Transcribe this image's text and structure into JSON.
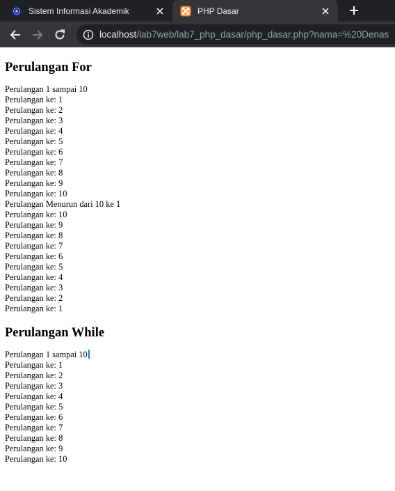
{
  "browser": {
    "tabs": [
      {
        "title": "Sistem Informasi Akademik",
        "active": false,
        "icon": "university-logo-icon"
      },
      {
        "title": "PHP Dasar",
        "active": true,
        "icon": "xampp-icon"
      }
    ],
    "url_host": "localhost",
    "url_path": "/lab7web/lab7_php_dasar/php_dasar.php?nama=%20Denas",
    "colors": {
      "tab_strip": "#202124",
      "toolbar": "#35363a",
      "xampp_orange": "#fb7a24"
    }
  },
  "page": {
    "for_section": {
      "heading": "Perulangan For",
      "lines": [
        "Perulangan 1 sampai 10",
        "Perulangan ke: 1",
        "Perulangan ke: 2",
        "Perulangan ke: 3",
        "Perulangan ke: 4",
        "Perulangan ke: 5",
        "Perulangan ke: 6",
        "Perulangan ke: 7",
        "Perulangan ke: 8",
        "Perulangan ke: 9",
        "Perulangan ke: 10",
        "Perulangan Menurun dari 10 ke 1",
        "Perulangan ke: 10",
        "Perulangan ke: 9",
        "Perulangan ke: 8",
        "Perulangan ke: 7",
        "Perulangan ke: 6",
        "Perulangan ke: 5",
        "Perulangan ke: 4",
        "Perulangan ke: 3",
        "Perulangan ke: 2",
        "Perulangan ke: 1"
      ]
    },
    "while_section": {
      "heading": "Perulangan While",
      "lines": [
        "Perulangan 1 sampai 10",
        "Perulangan ke: 1",
        "Perulangan ke: 2",
        "Perulangan ke: 3",
        "Perulangan ke: 4",
        "Perulangan ke: 5",
        "Perulangan ke: 6",
        "Perulangan ke: 7",
        "Perulangan ke: 8",
        "Perulangan ke: 9",
        "Perulangan ke: 10"
      ]
    }
  }
}
